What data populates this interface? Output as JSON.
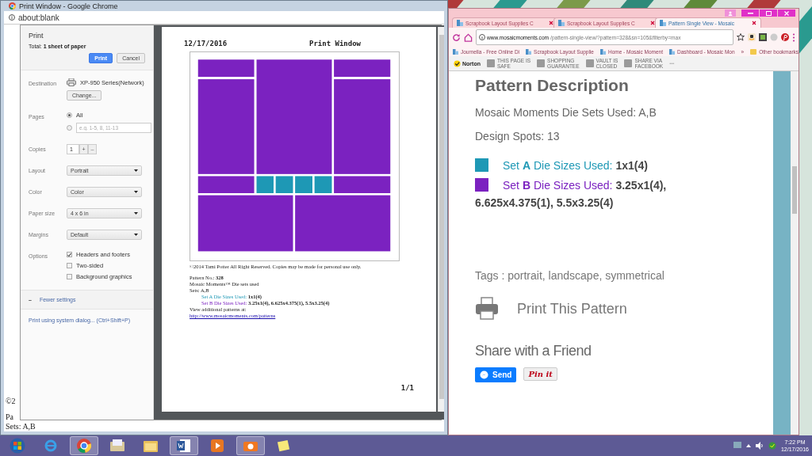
{
  "print_window": {
    "title": "Print Window - Google Chrome",
    "address": "about:blank",
    "behind_texts": [
      "©2",
      "Pa",
      "Sets: A,B"
    ],
    "dialog": {
      "title": "Print",
      "total_label": "Total:",
      "total": "1 sheet of paper",
      "buttons": [
        {
          "label": "Print",
          "kind": "primary"
        },
        {
          "label": "Cancel",
          "kind": "secondary"
        }
      ],
      "settings": [
        {
          "kind": "printer",
          "label": "Destination",
          "value": "XP-950 Series(Network)",
          "button": "Change..."
        },
        {
          "kind": "pages",
          "label": "Pages",
          "options": [
            {
              "label": "All",
              "selected": true
            },
            {
              "placeholder": "e.g. 1-5, 8, 11-13",
              "selected": false
            }
          ]
        },
        {
          "kind": "copies",
          "label": "Copies",
          "value": "1",
          "plus": "+",
          "minus": "–"
        },
        {
          "kind": "select",
          "label": "Layout",
          "value": "Portrait"
        },
        {
          "kind": "select",
          "label": "Color",
          "value": "Color"
        },
        {
          "kind": "select",
          "label": "Paper size",
          "value": "4 x 6 in"
        },
        {
          "kind": "select",
          "label": "Margins",
          "value": "Default"
        },
        {
          "kind": "checks",
          "label": "Options",
          "items": [
            {
              "label": "Headers and footers",
              "checked": true
            },
            {
              "label": "Two-sided",
              "checked": false
            },
            {
              "label": "Background graphics",
              "checked": false
            }
          ]
        }
      ],
      "fewer": {
        "icon": "–",
        "label": "Fewer settings"
      },
      "system_link": "Print using system dialog... (Ctrl+Shift+P)"
    },
    "preview": {
      "date": "12/17/2016",
      "title": "Print Window",
      "page_number": "1/1",
      "lines": [
        {
          "kind": "plain",
          "text": "©2014 Tami Potter All Right Reserved. Copies may be made for personal use only."
        },
        {
          "kind": "gap"
        },
        {
          "kind": "plain",
          "text": "Pattern No.: **328**"
        },
        {
          "kind": "plain",
          "text": "Mosaic Moments™ Die sets used"
        },
        {
          "kind": "plain",
          "text": "Sets: A,B"
        },
        {
          "kind": "set",
          "text": "Set A Die Sizes Used:",
          "sizes": "1x1(4)"
        },
        {
          "kind": "set",
          "text": "Set B Die Sizes Used:",
          "sizes": "3.25x1(4), 6.625x4.375(1), 5.5x3.25(4)"
        },
        {
          "kind": "plain",
          "text": "View additional patterns at:"
        },
        {
          "kind": "link",
          "text": "http://www.mosaicmoments.com/patterns"
        }
      ]
    }
  },
  "browser": {
    "tabs": [
      {
        "label": "Scrapbook Layout Supplies C",
        "selected": false
      },
      {
        "label": "Scrapbook Layout Supplies C",
        "selected": false
      },
      {
        "label": "Pattern Single View - Mosaic",
        "selected": true
      }
    ],
    "url_host": "www.mosaicmoments.com",
    "url_path": "/pattern-single-view/?pattern=328&sn=105&filterby=max",
    "bookmarks": [
      "Journella - Free Online Di",
      "Scrapbook Layout Supplie",
      "Home - Mosaic Moment",
      "Dashboard - Mosaic Mon"
    ],
    "bookmarks_more": "»",
    "other_bookmarks": "Other bookmarks",
    "norton": {
      "brand": "Norton",
      "items": [
        {
          "top": "THIS PAGE IS",
          "bottom": "SAFE"
        },
        {
          "top": "SHOPPING",
          "bottom": "GUARANTEE"
        },
        {
          "top": "VAULT IS",
          "bottom": "CLOSED"
        },
        {
          "top": "SHARE VIA",
          "bottom": "FACEBOOK"
        }
      ],
      "more": "•••"
    }
  },
  "page": {
    "heading": "Pattern Description",
    "die_sets": "Mosaic Moments Die Sets Used: A,B",
    "design_spots": "Design Spots: 13",
    "sets": [
      {
        "label": "Set **A** Die Sizes Used:",
        "sizes": "1x1(4)",
        "color": "#1e98b5"
      },
      {
        "label": "Set **B** Die Sizes Used:",
        "sizes": "3.25x1(4),",
        "color": "#7b22c0"
      }
    ],
    "sizes_continued": "6.625x4.375(1), 5.5x3.25(4)",
    "tags": "Tags : portrait, landscape, symmetrical",
    "print_link": "Print This Pattern",
    "share_heading": "Share with a Friend",
    "send": "Send",
    "pin": "Pin it"
  },
  "taskbar": {
    "time": "7:22 PM",
    "date": "12/17/2016"
  }
}
